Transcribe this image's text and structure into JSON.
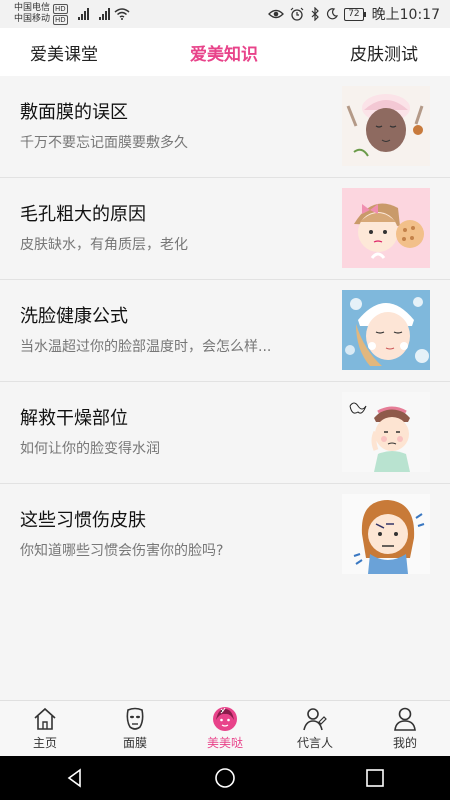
{
  "status_bar": {
    "carrier1": "中国电信",
    "carrier2": "中国移动",
    "hd_badge": "HD",
    "battery": "72",
    "time": "晚上10:17"
  },
  "top_tabs": [
    {
      "label": "爱美课堂",
      "active": false
    },
    {
      "label": "爱美知识",
      "active": true
    },
    {
      "label": "皮肤测试",
      "active": false
    }
  ],
  "articles": [
    {
      "title": "敷面膜的误区",
      "subtitle": "千万不要忘记面膜要敷多久",
      "thumb": "mask-face-illustration"
    },
    {
      "title": "毛孔粗大的原因",
      "subtitle": "皮肤缺水，有角质层，老化",
      "thumb": "pore-girl-illustration"
    },
    {
      "title": "洗脸健康公式",
      "subtitle": "当水温超过你的脸部温度时，会怎么样...",
      "thumb": "face-wash-illustration"
    },
    {
      "title": "解救干燥部位",
      "subtitle": "如何让你的脸变得水润",
      "thumb": "dry-skin-girl-illustration"
    },
    {
      "title": "这些习惯伤皮肤",
      "subtitle": "你知道哪些习惯会伤害你的脸吗?",
      "thumb": "worried-girl-illustration"
    }
  ],
  "bottom_nav": [
    {
      "label": "主页",
      "icon": "home-icon",
      "active": false
    },
    {
      "label": "面膜",
      "icon": "mask-icon",
      "active": false
    },
    {
      "label": "美美哒",
      "icon": "beauty-girl-icon",
      "active": true
    },
    {
      "label": "代言人",
      "icon": "spokesperson-icon",
      "active": false
    },
    {
      "label": "我的",
      "icon": "profile-icon",
      "active": false
    }
  ],
  "colors": {
    "accent": "#e8438a",
    "background": "#f5f5f5"
  }
}
